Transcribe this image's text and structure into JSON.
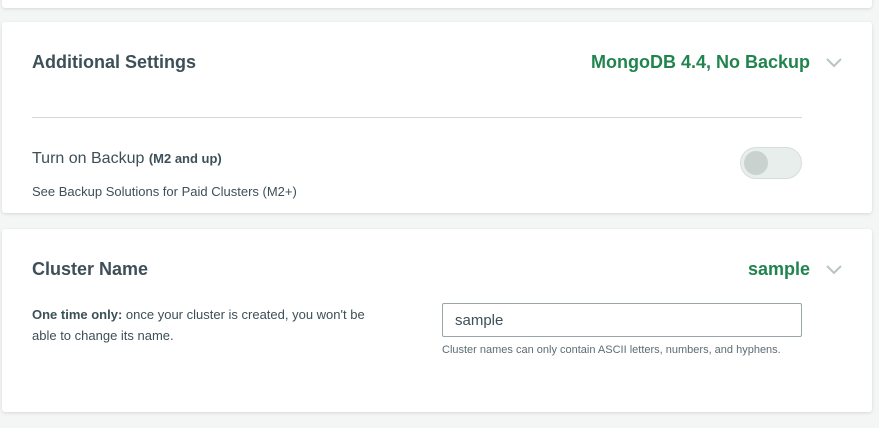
{
  "additional_settings": {
    "title": "Additional Settings",
    "summary": "MongoDB 4.4, No Backup",
    "backup": {
      "label": "Turn on Backup",
      "qualifier": "(M2 and up)",
      "link": "See Backup Solutions for Paid Clusters (M2+)",
      "enabled": false
    }
  },
  "cluster_name": {
    "title": "Cluster Name",
    "summary": "sample",
    "note_bold": "One time only:",
    "note_text": " once your cluster is created, you won't be able to change its name.",
    "input_value": "sample",
    "hint": "Cluster names can only contain ASCII letters, numbers, and hyphens."
  },
  "icons": {
    "collapse": "chevron-down-icon"
  },
  "colors": {
    "accent": "#21844f",
    "text": "#3d4f58",
    "background": "#f4f5f5"
  }
}
